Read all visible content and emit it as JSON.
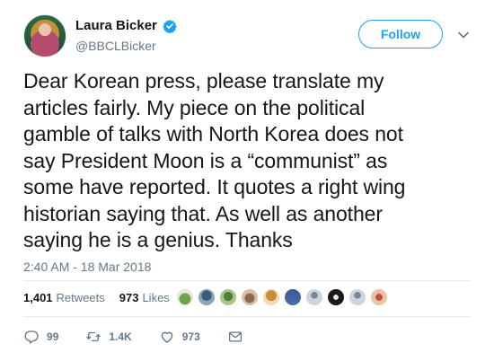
{
  "user": {
    "name": "Laura Bicker",
    "handle": "@BBCLBicker",
    "verified": true
  },
  "follow_button": {
    "label": "Follow"
  },
  "tweet": {
    "text": "Dear Korean press, please translate my\narticles fairly. My piece on the political\ngamble of talks with North Korea does not\nsay President Moon is a “communist” as\nsome have reported. It quotes a right wing\nhistorian saying that. As well as another\nsaying he is a genius. Thanks",
    "timestamp": "2:40 AM - 18 Mar 2018"
  },
  "stats": {
    "retweets_count": "1,401",
    "retweets_label": "Retweets",
    "likes_count": "973",
    "likes_label": "Likes"
  },
  "actions": {
    "reply_count": "99",
    "retweet_count": "1.4K",
    "like_count": "973"
  },
  "colors": {
    "accent": "#1da1f2",
    "muted": "#657786",
    "text": "#14171a",
    "divider": "#e6ecf0"
  },
  "icons": {
    "verified": "verified-badge-icon",
    "caret": "chevron-down-icon",
    "reply": "reply-icon",
    "retweet": "retweet-icon",
    "like": "heart-icon",
    "dm": "envelope-icon"
  }
}
